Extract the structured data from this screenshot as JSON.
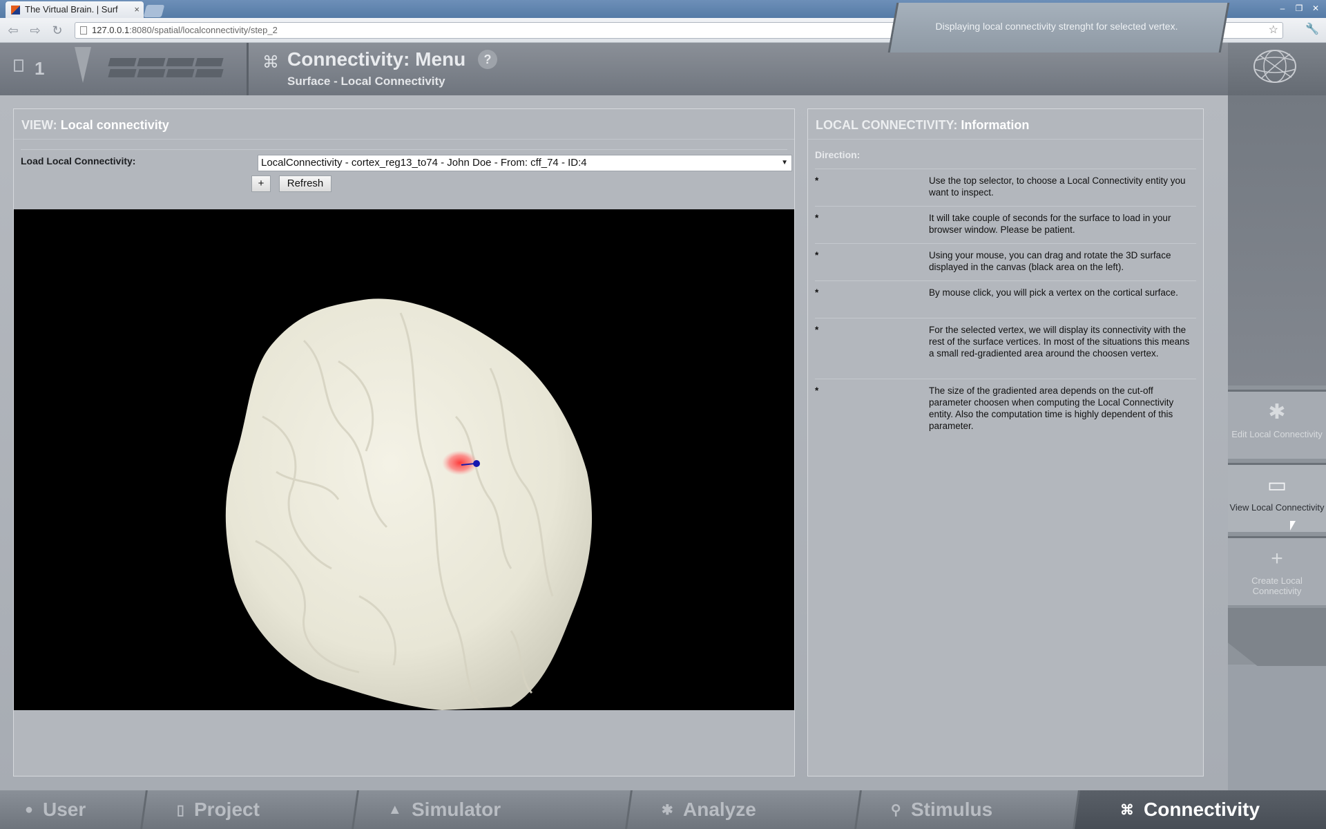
{
  "browser": {
    "tab_title": "The Virtual Brain. | Surf",
    "tab_close": "×",
    "url_host": "127.0.0.1",
    "url_path": ":8080/spatial/localconnectivity/step_2"
  },
  "header": {
    "project_number": "1",
    "menu_title": "Connectivity: Menu",
    "help": "?",
    "subtitle": "Surface - Local Connectivity",
    "message": "Displaying local connectivity strenght for selected vertex."
  },
  "view_panel": {
    "title_lead": "VIEW:",
    "title_main": "Local connectivity",
    "load_label": "Load Local Connectivity:",
    "selected_value": "LocalConnectivity - cortex_reg13_to74 - John Doe - From: cff_74 - ID:4",
    "plus_button": "+",
    "refresh_button": "Refresh"
  },
  "info_panel": {
    "title_lead": "LOCAL CONNECTIVITY:",
    "title_main": "Information",
    "direction_label": "Direction:",
    "bullet": "*",
    "items": [
      "Use the top selector, to choose a Local Connectivity entity you want to inspect.",
      "It will take couple of seconds for the surface to load in your browser window. Please be patient.",
      "Using your mouse, you can drag and rotate the 3D surface displayed in the canvas (black area on the left).",
      "By mouse click, you will pick a vertex on the cortical surface.",
      "For the selected vertex, we will display its connectivity with the rest of the surface vertices. In most of the situations this means a small red-gradiented area around the choosen vertex.",
      "The size of the gradiented area depends on the cut-off parameter choosen when computing the Local Connectivity entity. Also the computation time is highly dependent of this parameter."
    ]
  },
  "side_tools": [
    {
      "label": "Edit Local Connectivity",
      "icon": "gear-icon"
    },
    {
      "label": "View Local Connectivity",
      "icon": "monitor-icon"
    },
    {
      "label": "Create Local Connectivity",
      "icon": "plus-icon"
    }
  ],
  "bottom_nav": [
    {
      "label": "User",
      "icon": "user-icon"
    },
    {
      "label": "Project",
      "icon": "document-icon"
    },
    {
      "label": "Simulator",
      "icon": "rocket-icon"
    },
    {
      "label": "Analyze",
      "icon": "gear-icon"
    },
    {
      "label": "Stimulus",
      "icon": "pin-icon"
    },
    {
      "label": "Connectivity",
      "icon": "connectivity-icon"
    }
  ]
}
